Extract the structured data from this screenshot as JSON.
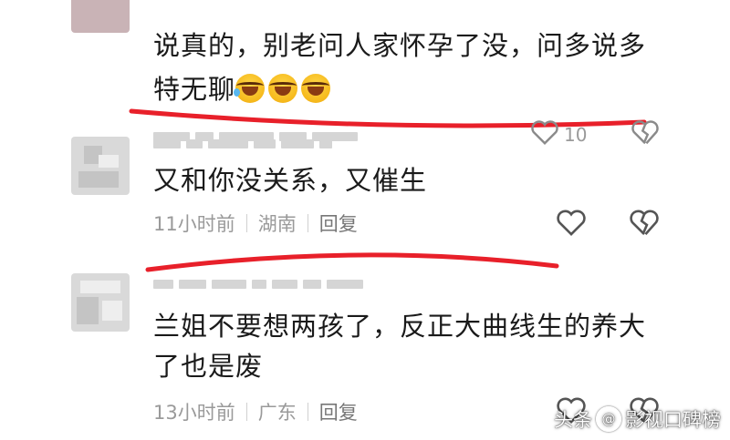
{
  "comments": [
    {
      "text_line1": "说真的，别老问人家怀孕了没，问多说多",
      "text_line2": "特无聊",
      "like_count": "10"
    },
    {
      "text_line1": "又和你没关系，又催生",
      "time": "11小时前",
      "location": "湖南",
      "reply_label": "回复"
    },
    {
      "text_line1": "兰姐不要想两孩了，反正大曲线生的养大",
      "text_line2": "了也是废",
      "time": "13小时前",
      "location": "广东",
      "reply_label": "回复"
    }
  ],
  "icons": {
    "emoji": "laughing-crying-emoji",
    "like": "heart-outline-icon",
    "dislike": "broken-heart-icon"
  },
  "annotation_color": "#e8202a",
  "watermark": {
    "brand": "头条",
    "author": "@影视口碑榜"
  }
}
